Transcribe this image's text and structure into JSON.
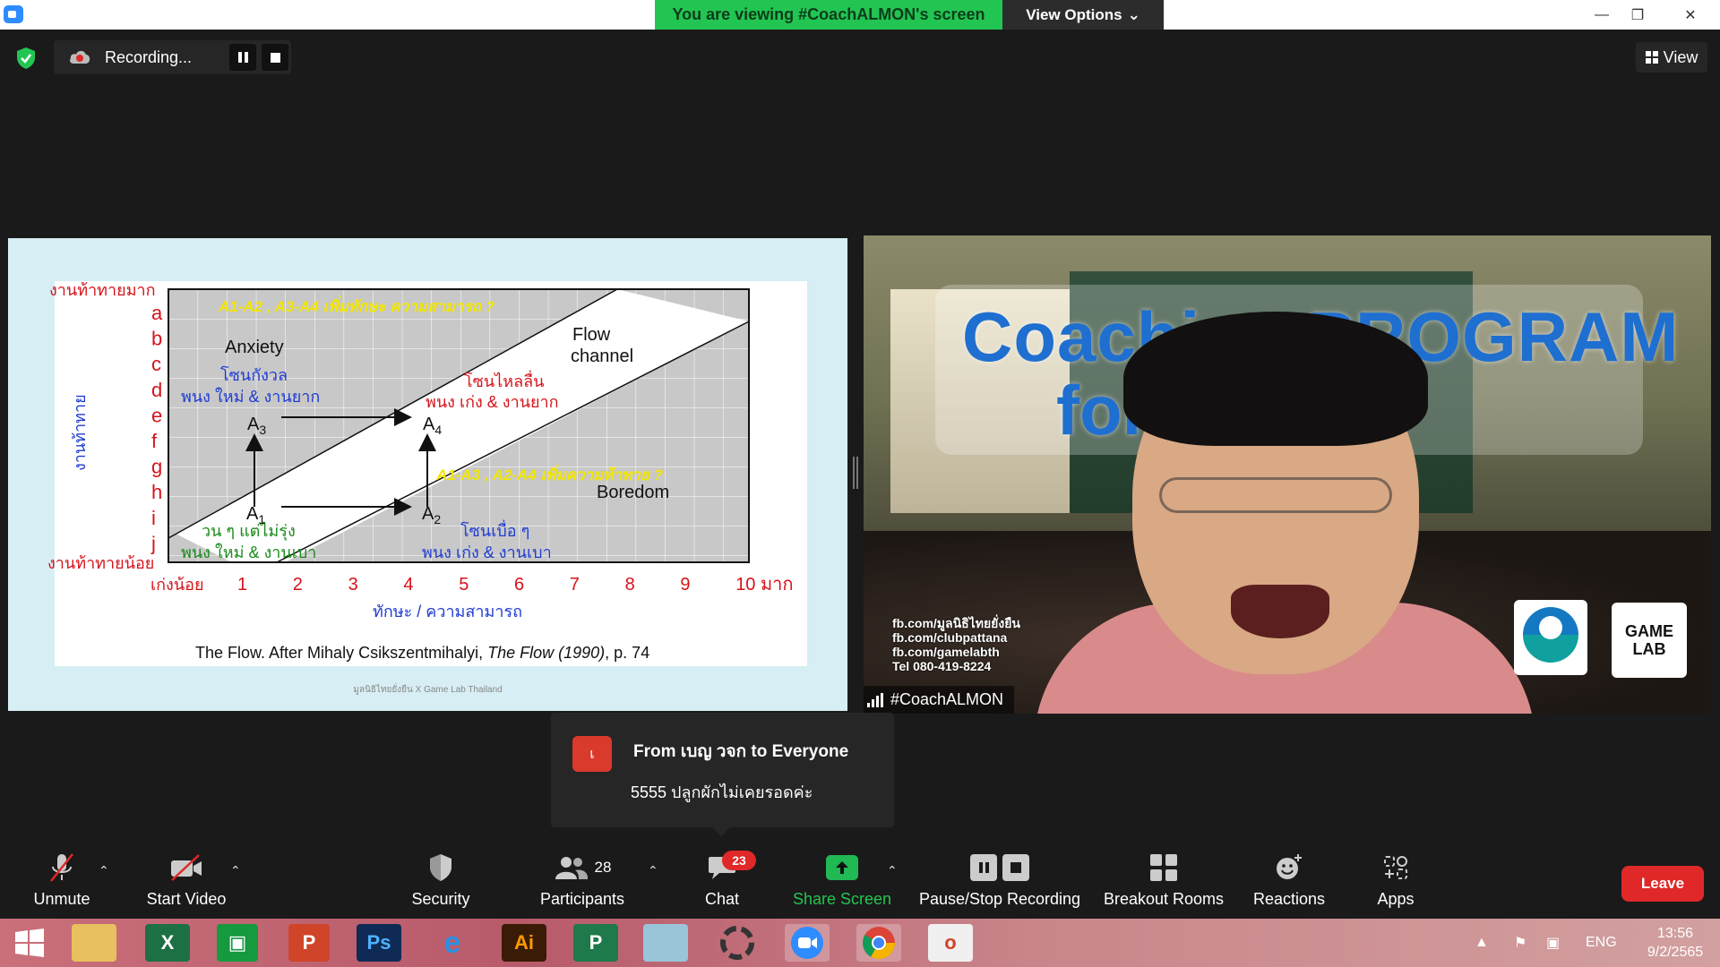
{
  "titlebar": {
    "banner": "You are viewing #CoachALMON's screen",
    "view_options": "View Options"
  },
  "recording": {
    "label": "Recording..."
  },
  "view_button": "View",
  "slide": {
    "top_y_label": "งานท้าทายมาก",
    "bottom_y_label": "งานท้าทายน้อย",
    "y_axis_title": "งานท้าทาย",
    "x_left_label": "เก่งน้อย",
    "x_axis_title": "ทักษะ / ความสามารถ",
    "letters": [
      "a",
      "b",
      "c",
      "d",
      "e",
      "f",
      "g",
      "h",
      "i",
      "j"
    ],
    "x_ticks": [
      "1",
      "2",
      "3",
      "4",
      "5",
      "6",
      "7",
      "8",
      "9",
      "10 มาก"
    ],
    "q_top": "A1-A2 , A3-A4 เพิ่มทักษะ ความสามารถ ?",
    "q_mid": "A1-A3 , A2-A4 เพิ่มความท้าทาย ?",
    "anxiety": "Anxiety",
    "anxiety_th": "โซนกังวล",
    "anxiety_sub": "พนง ใหม่ & งานยาก",
    "flow1": "Flow",
    "flow2": "channel",
    "flow_th": "โซนไหลลื่น",
    "flow_sub": "พนง เก่ง & งานยาก",
    "boredom": "Boredom",
    "boredom_th": "โซนเบื่อ ๆ",
    "boredom_sub": "พนง เก่ง & งานเบา",
    "apathy_th": "วน ๆ แต่ไม่รุ่ง",
    "apathy_sub": "พนง ใหม่ & งานเบา",
    "a1": "A",
    "a1s": "1",
    "a2": "A",
    "a2s": "2",
    "a3": "A",
    "a3s": "3",
    "a4": "A",
    "a4s": "4",
    "caption_pre": "The Flow.  After Mihaly Csikszentmihalyi, ",
    "caption_it": "The Flow (1990)",
    "caption_post": ", p. 74",
    "footer": "มูลนิธิไทยยั่งยืน X Game Lab Thailand"
  },
  "camera": {
    "title1": "Coaching PROGRAM",
    "title2": "for       er",
    "fb": [
      "fb.com/มูลนิธิไทยยั่งยืน",
      "fb.com/clubpattana",
      "fb.com/gamelabth",
      "Tel 080-419-8224"
    ],
    "gamelab1": "GAME",
    "gamelab2": "LAB",
    "name": "#CoachALMON"
  },
  "chat": {
    "avatar": "เ",
    "from": "From เบญ วจก to Everyone",
    "message": "5555 ปลูกผักไม่เคยรอดค่ะ"
  },
  "toolbar": {
    "unmute": "Unmute",
    "start_video": "Start Video",
    "security": "Security",
    "participants": "Participants",
    "participants_count": "28",
    "chat": "Chat",
    "chat_badge": "23",
    "share_screen": "Share Screen",
    "pause_stop": "Pause/Stop Recording",
    "breakout": "Breakout Rooms",
    "reactions": "Reactions",
    "apps": "Apps",
    "leave": "Leave"
  },
  "taskbar": {
    "lang": "ENG",
    "time": "13:56",
    "date": "9/2/2565"
  },
  "colors": {
    "banner_green": "#23c552",
    "share_green": "#20b954",
    "leave_red": "#e02828",
    "slide_red": "#d6131b",
    "slide_blue": "#1f3cd1",
    "slide_yellow": "#f2e600"
  }
}
